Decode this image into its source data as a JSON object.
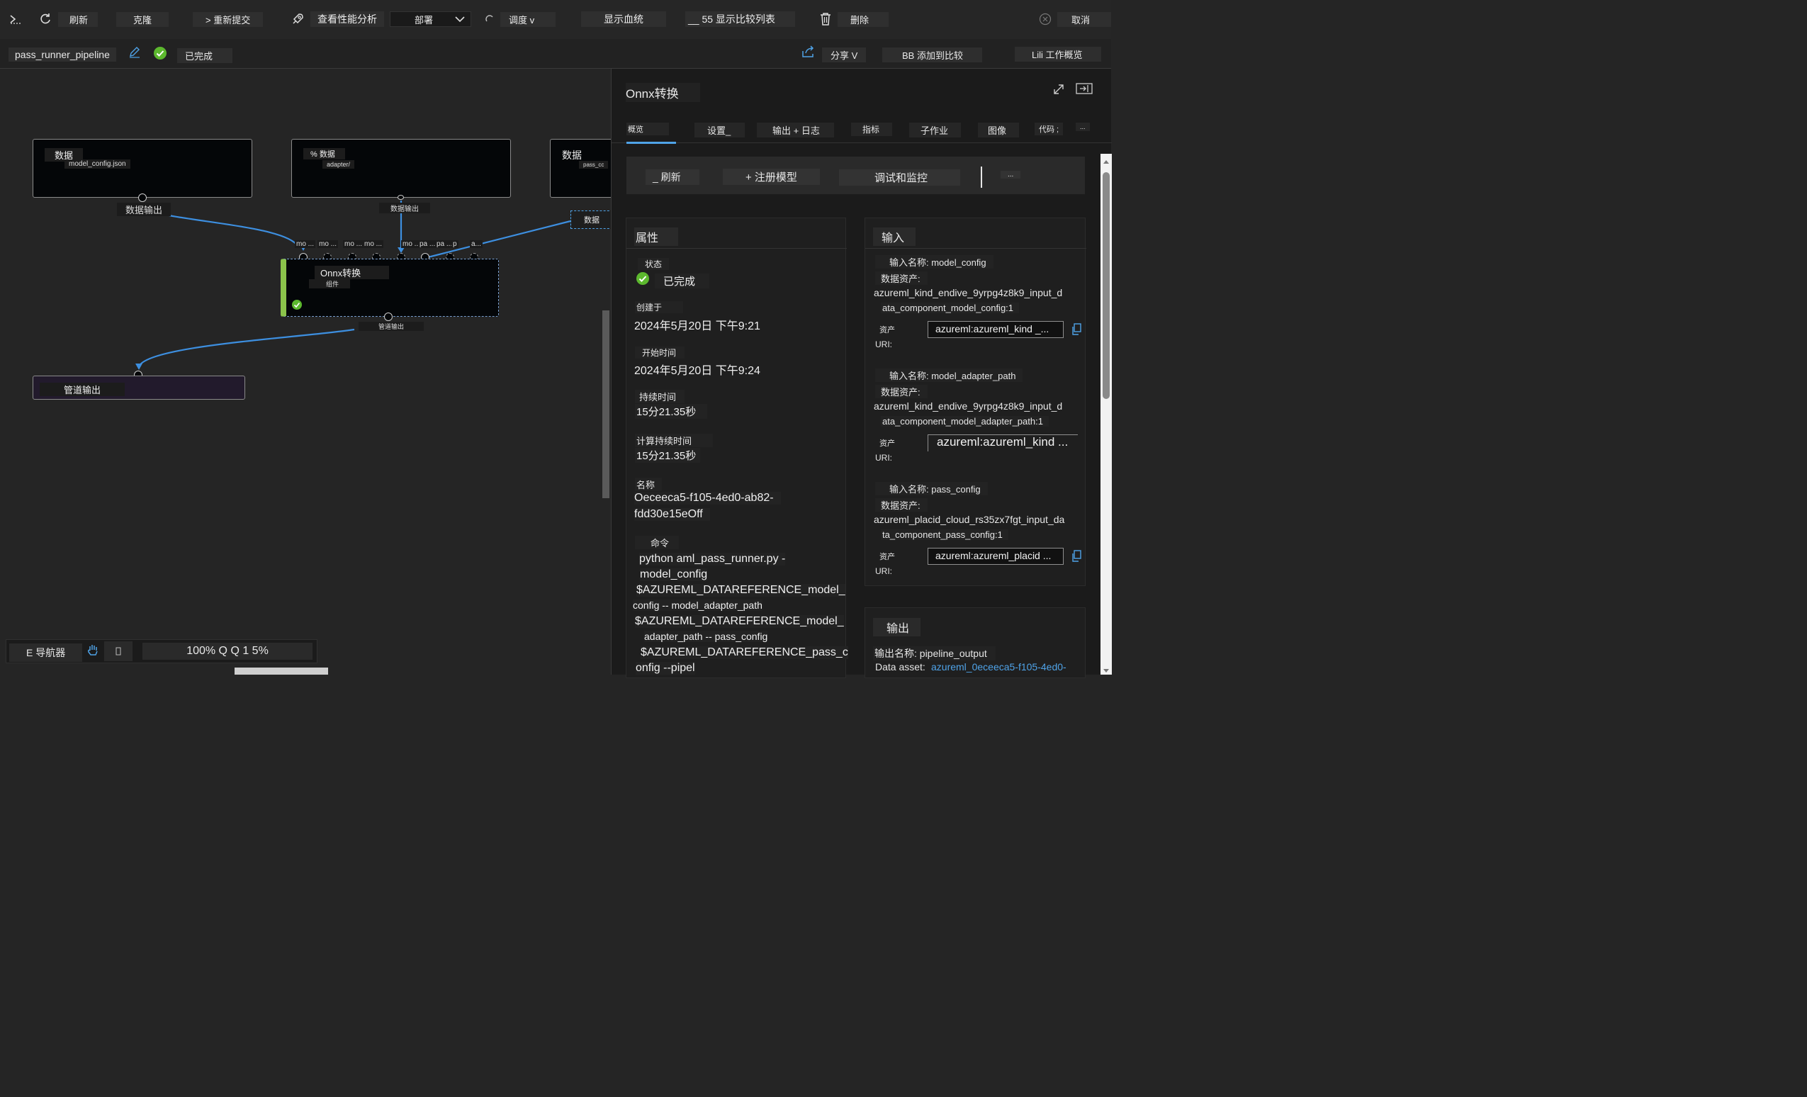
{
  "toolbar": {
    "refresh": "刷新",
    "clone": "克隆",
    "resubmit": "> 重新提交",
    "perf": "查看性能分析",
    "deploy": "部署",
    "schedule": "调度 v",
    "lineage": "显示血统",
    "compare_list": "__ 55 显示比较列表",
    "delete": "删除",
    "cancel": "取消"
  },
  "subbar": {
    "pipeline_name": "pass_runner_pipeline",
    "status": "已完成",
    "share": "分享 V",
    "add_compare": "BB 添加到比较",
    "overview": "Lili 工作概览"
  },
  "canvas": {
    "nodes": [
      {
        "title": "数据",
        "sub": "model_config.json",
        "out_label": "数据输出"
      },
      {
        "title": "% 数据",
        "sub": "adapter/",
        "out_label": "数据输出"
      },
      {
        "title": "数据",
        "sub": "pass_cc"
      }
    ],
    "dashed_node_label": "数据",
    "onnx": {
      "title": "Onnx转换",
      "sub": "组件",
      "out_label": "管道输出",
      "port_labels": [
        "mo ...",
        "mo ...",
        "mo ...",
        "mo ...",
        "mo ...",
        "pa ...",
        "pa ...",
        "p",
        "a..."
      ]
    },
    "pipeline_output": "管道输出",
    "navigator": "E 导航器",
    "zoom": "100% Q Q 1 5%"
  },
  "panel": {
    "title": "Onnx转换",
    "tabs": [
      "概览",
      "设置_",
      "输出 + 日志",
      "指标",
      "子作业",
      "图像",
      "代码 ;",
      "..."
    ],
    "actions": {
      "refresh": "_ 刷新",
      "register": "+ 注册模型",
      "debug": "调试和监控",
      "more": "..."
    },
    "properties": {
      "heading": "属性",
      "status_label": "状态",
      "status": "已完成",
      "created_label": "创建于",
      "created": "2024年5月20日 下午9:21",
      "start_label": "开始时间",
      "start": "2024年5月20日 下午9:24",
      "duration_label": "持续时间",
      "duration": "15分21.35秒",
      "compute_duration_label": "计算持续时间",
      "compute_duration": "15分21.35秒",
      "name_label": "名称",
      "name_line1": "Oeceeca5-f105-4ed0-ab82-",
      "name_line2": "fdd30e15eOff",
      "command_label": "命令",
      "command_lines": [
        "python aml_pass_runner.py -",
        "model_config",
        "$AZUREML_DATAREFERENCE_model_",
        "config -- model_adapter_path",
        "$AZUREML_DATAREFERENCE_model_",
        "adapter_path -- pass_config",
        "$AZUREML_DATAREFERENCE_pass_c",
        "onfig --pipel"
      ]
    },
    "inputs": {
      "heading": "输入",
      "items": [
        {
          "name_label": "输入名称: model_config",
          "asset_label": "数据资产:",
          "asset_l1": "azureml_kind_endive_9yrpg4z8k9_input_d",
          "asset_l2": "ata_component_model_config:1",
          "uri_label_1": "资产",
          "uri_label_2": "URI:",
          "uri": "azureml:azureml_kind _..."
        },
        {
          "name_label": "输入名称: model_adapter_path",
          "asset_label": "数据资产:",
          "asset_l1": "azureml_kind_endive_9yrpg4z8k9_input_d",
          "asset_l2": "ata_component_model_adapter_path:1",
          "uri_label_1": "资产",
          "uri_label_2": "URI:",
          "uri": "azureml:azureml_kind ..."
        },
        {
          "name_label": "输入名称: pass_config",
          "asset_label": "数据资产:",
          "asset_l1": "azureml_placid_cloud_rs35zx7fgt_input_da",
          "asset_l2": "ta_component_pass_config:1",
          "uri_label_1": "资产",
          "uri_label_2": "URI:",
          "uri": "azureml:azureml_placid ..."
        }
      ]
    },
    "outputs": {
      "heading": "输出",
      "name_label": "输出名称: pipeline_output",
      "asset_prefix": "Data asset:",
      "asset_link": "azureml_0eceeca5-f105-4ed0-"
    }
  },
  "colors": {
    "accent": "#4fa3e8",
    "success": "#5cb82e",
    "edge": "#3d8fe0"
  }
}
